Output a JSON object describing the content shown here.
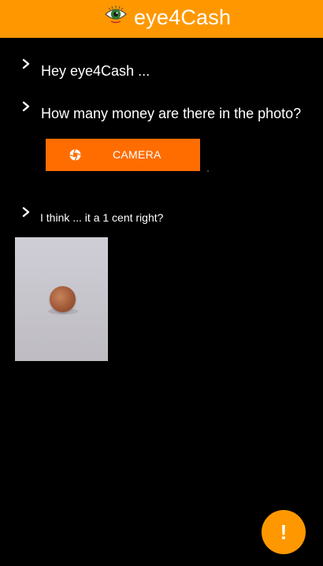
{
  "appbar": {
    "title": "eye4Cash",
    "logo_icon": "eye-icon",
    "background": "#ff9800"
  },
  "messages": [
    {
      "text": "Hey eye4Cash ...",
      "icon": "chevron-right-icon"
    },
    {
      "text": "How many money are there in the photo?",
      "icon": "chevron-right-icon"
    },
    {
      "text": "I think ... it a 1 cent right?",
      "icon": "chevron-right-icon"
    }
  ],
  "camera_button": {
    "label": "CAMERA",
    "icon": "camera-shutter-icon",
    "background": "#ff6d00"
  },
  "photo": {
    "subject": "coin-photo"
  },
  "fab": {
    "label": "!",
    "icon": "exclamation-icon",
    "background": "#ff9800"
  }
}
